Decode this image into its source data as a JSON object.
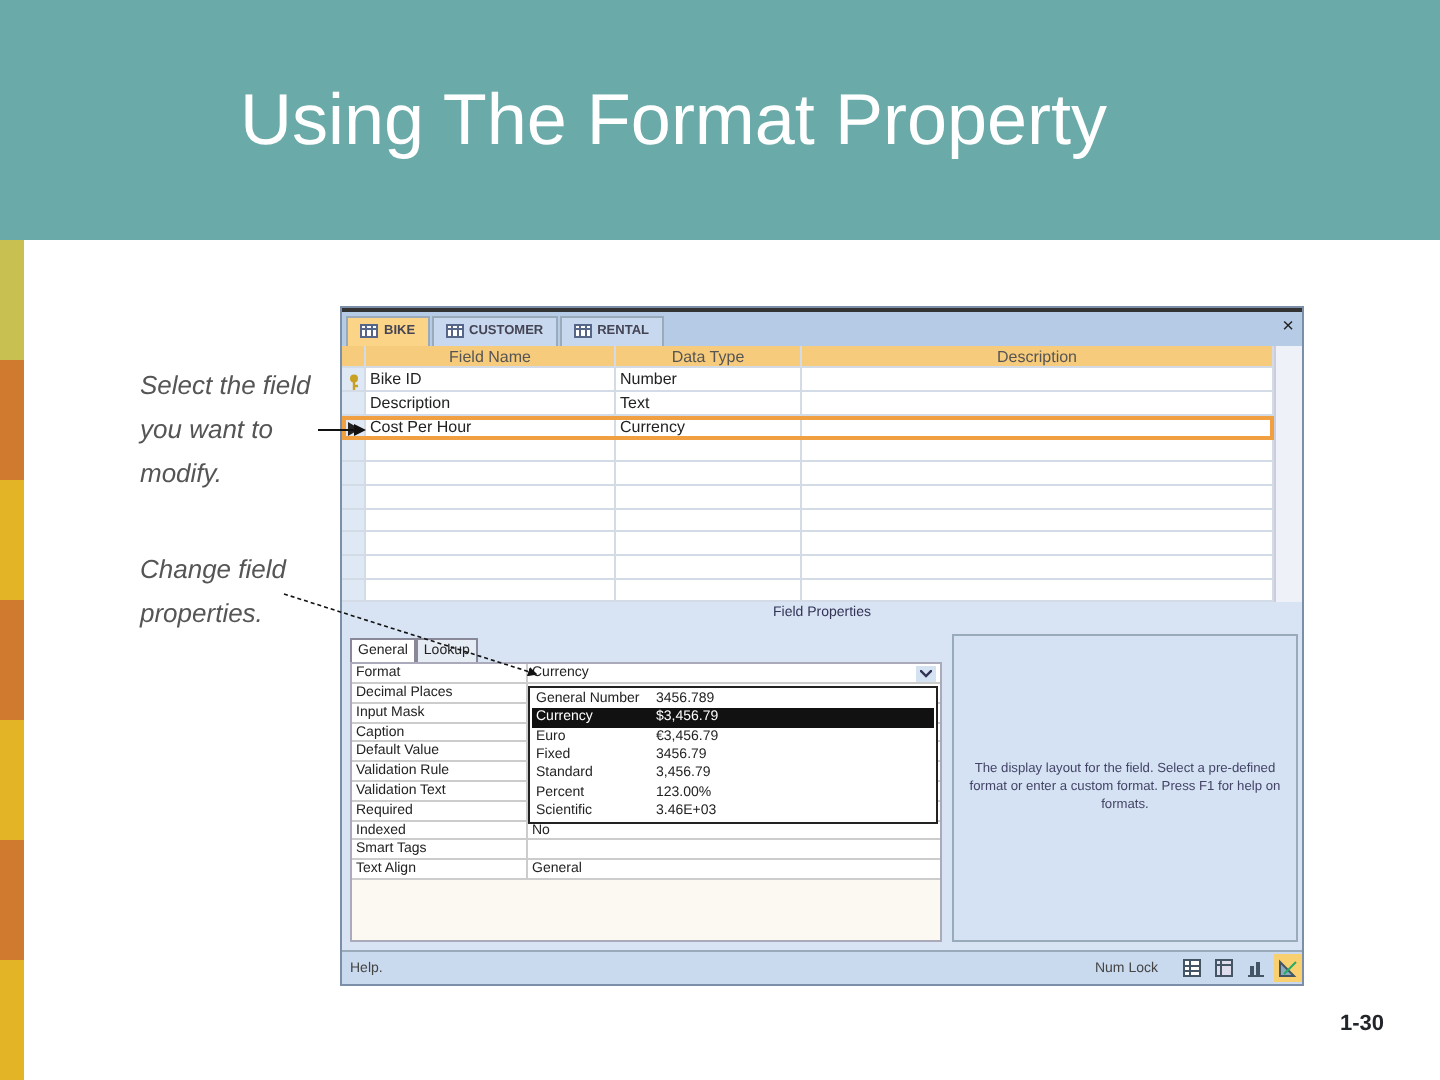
{
  "slide": {
    "title": "Using The Format Property",
    "page_number": "1-30"
  },
  "callouts": [
    {
      "text": "Select the field you want to modify."
    },
    {
      "text": "Change field properties."
    }
  ],
  "window": {
    "tabs": [
      {
        "label": "BIKE",
        "selected": true
      },
      {
        "label": "CUSTOMER",
        "selected": false
      },
      {
        "label": "RENTAL",
        "selected": false
      }
    ],
    "close": "×",
    "columns": [
      "Field Name",
      "Data Type",
      "Description"
    ],
    "rows": [
      {
        "field_name": "Bike ID",
        "data_type": "Number",
        "primary_key": true,
        "selected": false
      },
      {
        "field_name": "Description",
        "data_type": "Text",
        "primary_key": false,
        "selected": false
      },
      {
        "field_name": "Cost Per Hour",
        "data_type": "Currency",
        "primary_key": false,
        "selected": true
      }
    ],
    "field_properties_title": "Field Properties",
    "property_tabs": [
      {
        "label": "General",
        "selected": true
      },
      {
        "label": "Lookup",
        "selected": false
      }
    ],
    "properties": [
      {
        "name": "Format",
        "value": "Currency",
        "kind": "dropdown"
      },
      {
        "name": "Decimal Places",
        "kind": "text"
      },
      {
        "name": "Input Mask",
        "kind": "text"
      },
      {
        "name": "Caption",
        "kind": "text"
      },
      {
        "name": "Default Value",
        "kind": "text"
      },
      {
        "name": "Validation Rule",
        "kind": "text"
      },
      {
        "name": "Validation Text",
        "kind": "text"
      },
      {
        "name": "Required",
        "kind": "text"
      },
      {
        "name": "Indexed",
        "value": "No",
        "kind": "text"
      },
      {
        "name": "Smart Tags",
        "kind": "text"
      },
      {
        "name": "Text Align",
        "value": "General",
        "kind": "text"
      }
    ],
    "format_options": [
      {
        "label": "General Number",
        "sample": "3456.789",
        "selected": false
      },
      {
        "label": "Currency",
        "sample": "$3,456.79",
        "selected": true
      },
      {
        "label": "Euro",
        "sample": "€3,456.79",
        "selected": false
      },
      {
        "label": "Fixed",
        "sample": "3456.79",
        "selected": false
      },
      {
        "label": "Standard",
        "sample": "3,456.79",
        "selected": false
      },
      {
        "label": "Percent",
        "sample": "123.00%",
        "selected": false
      },
      {
        "label": "Scientific",
        "sample": "3.46E+03",
        "selected": false
      }
    ],
    "help_text": "The display layout for the field.  Select a pre-defined format or enter a custom format.  Press F1 for help on formats.",
    "status_bar": {
      "text": "Help.",
      "num_lock": "Num Lock",
      "views": [
        {
          "kind": "grid",
          "selected": false
        },
        {
          "kind": "pivot",
          "selected": false
        },
        {
          "kind": "chart",
          "selected": false
        },
        {
          "kind": "design",
          "selected": true
        }
      ]
    }
  }
}
